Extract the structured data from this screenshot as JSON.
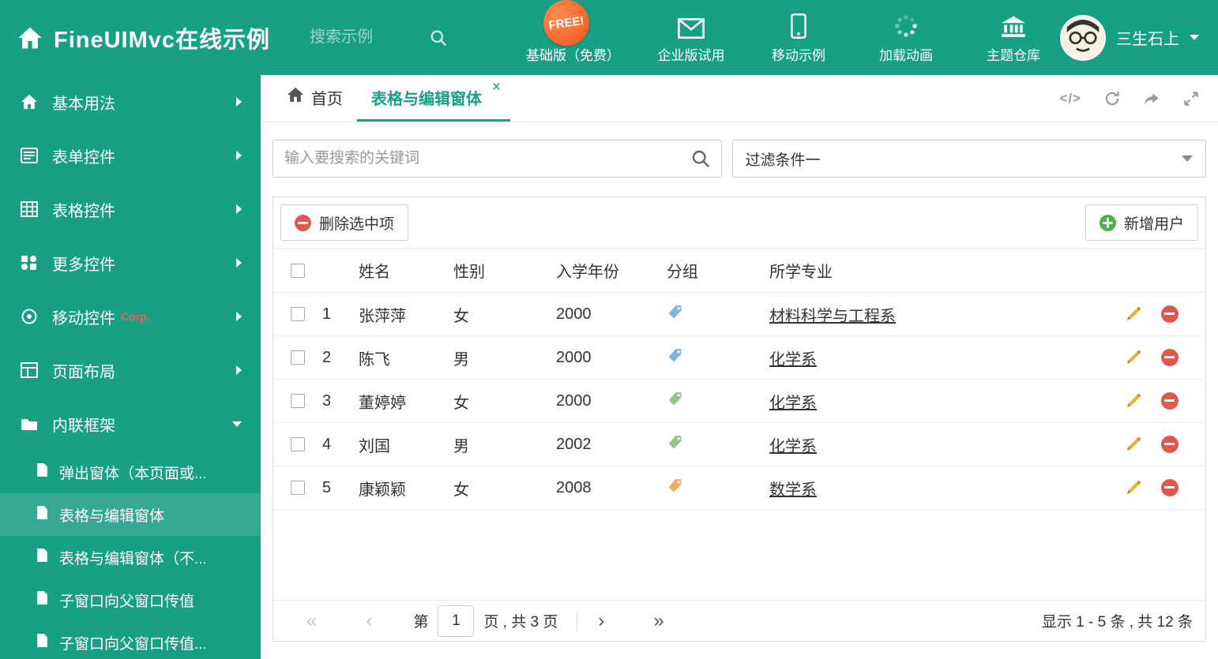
{
  "topbar": {
    "title": "FineUIMvc在线示例",
    "search_placeholder": "搜索示例",
    "free_badge": "FREE!",
    "menu": [
      {
        "label": "基础版（免费）"
      },
      {
        "label": "企业版试用"
      },
      {
        "label": "移动示例"
      },
      {
        "label": "加载动画"
      },
      {
        "label": "主题仓库"
      }
    ],
    "user_name": "三生石上"
  },
  "sidebar": {
    "items": [
      {
        "label": "基本用法"
      },
      {
        "label": "表单控件"
      },
      {
        "label": "表格控件"
      },
      {
        "label": "更多控件"
      },
      {
        "label": "移动控件",
        "badge": "Corp."
      },
      {
        "label": "页面布局"
      },
      {
        "label": "内联框架"
      }
    ],
    "subitems": [
      {
        "label": "弹出窗体（本页面或..."
      },
      {
        "label": "表格与编辑窗体"
      },
      {
        "label": "表格与编辑窗体（不..."
      },
      {
        "label": "子窗口向父窗口传值"
      },
      {
        "label": "子窗口向父窗口传值..."
      }
    ]
  },
  "tabs": {
    "home": "首页",
    "active": "表格与编辑窗体",
    "close": "×"
  },
  "filter": {
    "search_placeholder": "输入要搜索的关键词",
    "dropdown_value": "过滤条件一"
  },
  "toolbar": {
    "delete_label": "删除选中项",
    "add_label": "新增用户"
  },
  "table": {
    "headers": {
      "name": "姓名",
      "gender": "性别",
      "year": "入学年份",
      "group": "分组",
      "major": "所学专业"
    },
    "rows": [
      {
        "num": "1",
        "name": "张萍萍",
        "gender": "女",
        "year": "2000",
        "major": "材料科学与工程系",
        "tag_color": "#79b7e3"
      },
      {
        "num": "2",
        "name": "陈飞",
        "gender": "男",
        "year": "2000",
        "major": "化学系",
        "tag_color": "#79b7e3"
      },
      {
        "num": "3",
        "name": "董婷婷",
        "gender": "女",
        "year": "2000",
        "major": "化学系",
        "tag_color": "#8fc57f"
      },
      {
        "num": "4",
        "name": "刘国",
        "gender": "男",
        "year": "2002",
        "major": "化学系",
        "tag_color": "#8fc57f"
      },
      {
        "num": "5",
        "name": "康颖颖",
        "gender": "女",
        "year": "2008",
        "major": "数学系",
        "tag_color": "#f2aa60"
      }
    ]
  },
  "pagination": {
    "first": "«",
    "prev": "‹",
    "next": "›",
    "last": "»",
    "prefix": "第",
    "page_value": "1",
    "suffix": "页 , 共 3 页",
    "summary": "显示 1 - 5 条 , 共 12 条"
  },
  "icons": {
    "code": "</>"
  },
  "colors": {
    "accent": "#18a085",
    "free_badge": "#f4541d",
    "delete_red": "#e2574c",
    "add_green": "#4cae4c"
  }
}
